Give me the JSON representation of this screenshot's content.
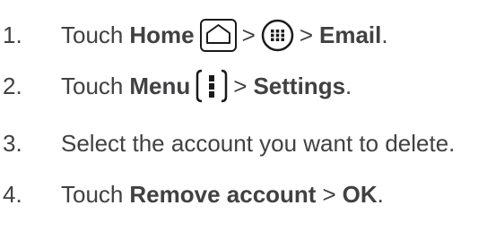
{
  "steps": [
    {
      "number": "1.",
      "parts": {
        "verb": "Touch",
        "target": "Home",
        "sep1": ">",
        "sep2": ">",
        "final": "Email",
        "end": "."
      },
      "icons": [
        "home-icon",
        "apps-icon"
      ]
    },
    {
      "number": "2.",
      "parts": {
        "verb": "Touch",
        "target": "Menu",
        "sep1": ">",
        "final": "Settings",
        "end": "."
      },
      "icons": [
        "menu-icon"
      ]
    },
    {
      "number": "3.",
      "parts": {
        "text": "Select the account you want to delete."
      }
    },
    {
      "number": "4.",
      "parts": {
        "verb": "Touch",
        "target": "Remove account",
        "sep1": ">",
        "final": "OK",
        "end": "."
      }
    }
  ],
  "colors": {
    "text": "#414042",
    "icon": "#1a1a1a"
  }
}
